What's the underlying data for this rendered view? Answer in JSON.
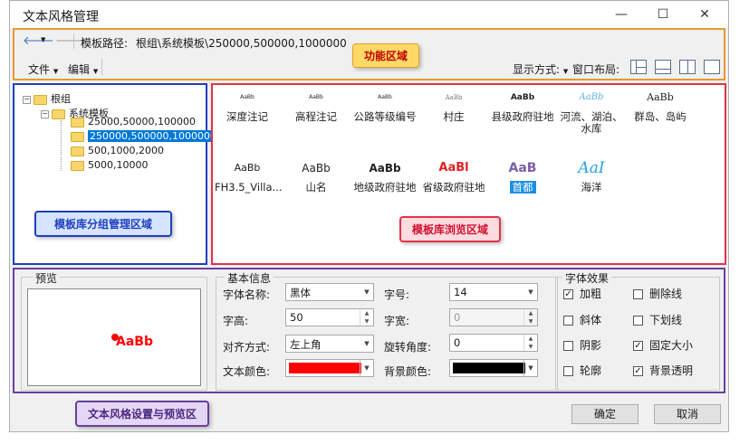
{
  "window": {
    "title": "文本风格管理",
    "min": "—",
    "max": "☐",
    "close": "✕"
  },
  "toolbar": {
    "path_label": "模板路径:",
    "path_value": "根组\\系统模板\\250000,500000,1000000",
    "menu_file": "文件",
    "menu_edit": "编辑",
    "display_mode": "显示方式:",
    "window_layout": "窗口布局:"
  },
  "callouts": {
    "function_area": "功能区域",
    "library_group": "模板库分组管理区域",
    "library_browse": "模板库浏览区域",
    "style_settings": "文本风格设置与预览区"
  },
  "tree": {
    "root": "根组",
    "system": "系统模板",
    "children": [
      "25000,50000,100000",
      "250000,500000,1000000",
      "500,1000,2000",
      "5000,10000"
    ]
  },
  "templates": [
    {
      "sample": "AaBb",
      "label": "深度注记"
    },
    {
      "sample": "AaBb",
      "label": "高程注记"
    },
    {
      "sample": "AaBb",
      "label": "公路等级编号"
    },
    {
      "sample": "AaBb",
      "label": "村庄"
    },
    {
      "sample": "AaBb",
      "label": "县级政府驻地"
    },
    {
      "sample": "AaBb",
      "label": "河流、湖泊、水库"
    },
    {
      "sample": "AaBb",
      "label": "群岛、岛屿"
    },
    {
      "sample": "AaBb",
      "label": "FH3.5_Villa..."
    },
    {
      "sample": "AaBb",
      "label": "山名"
    },
    {
      "sample": "AaBb",
      "label": "地级政府驻地"
    },
    {
      "sample": "AaBl",
      "label": "省级政府驻地"
    },
    {
      "sample": "AaB",
      "label": "首都"
    },
    {
      "sample": "AaI",
      "label": "海洋"
    }
  ],
  "preview": {
    "title": "预览",
    "sample": "AaBb"
  },
  "basic_info": {
    "title": "基本信息",
    "font_name_label": "字体名称:",
    "font_name": "黑体",
    "font_size_label": "字号:",
    "font_size": "14",
    "font_height_label": "字高:",
    "font_height": "50",
    "font_width_label": "字宽:",
    "font_width": "0",
    "align_label": "对齐方式:",
    "align": "左上角",
    "rotation_label": "旋转角度:",
    "rotation": "0",
    "text_color_label": "文本颜色:",
    "text_color": "#ff0000",
    "bg_color_label": "背景颜色:",
    "bg_color": "#000000"
  },
  "effects": {
    "title": "字体效果",
    "bold": "加粗",
    "strikeout": "删除线",
    "italic": "斜体",
    "underline": "下划线",
    "shadow": "阴影",
    "fixed_size": "固定大小",
    "outline": "轮廓",
    "bg_transparent": "背景透明"
  },
  "buttons": {
    "ok": "确定",
    "cancel": "取消"
  }
}
